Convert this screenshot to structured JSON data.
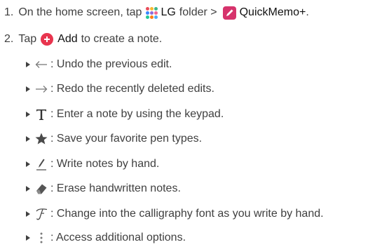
{
  "steps": {
    "one": {
      "number": "1.",
      "pre": "On the home screen, tap",
      "folder_label": "LG",
      "folder_suffix": "folder >",
      "app_label": "QuickMemo+",
      "post": "."
    },
    "two": {
      "number": "2.",
      "pre": "Tap",
      "add_label": "Add",
      "post": "to create a note."
    }
  },
  "tools": [
    {
      "icon": "undo-arrow-icon",
      "text": ": Undo the previous edit."
    },
    {
      "icon": "redo-arrow-icon",
      "text": ": Redo the recently deleted edits."
    },
    {
      "icon": "text-t-icon",
      "text": ": Enter a note by using the keypad."
    },
    {
      "icon": "star-icon",
      "text": ": Save your favorite pen types."
    },
    {
      "icon": "pen-icon",
      "text": ": Write notes by hand."
    },
    {
      "icon": "eraser-icon",
      "text": ": Erase handwritten notes."
    },
    {
      "icon": "calligraphy-icon",
      "text": ": Change into the calligraphy font as you write by hand."
    },
    {
      "icon": "more-options-icon",
      "text": ": Access additional options."
    }
  ],
  "colors": {
    "body_text": "#404040",
    "emphasis_text": "#111111",
    "memo_app": "#d6336c",
    "add_button": "#e8344e",
    "tool_icon": "#555555",
    "arrow_icon": "#7a7a7a"
  }
}
